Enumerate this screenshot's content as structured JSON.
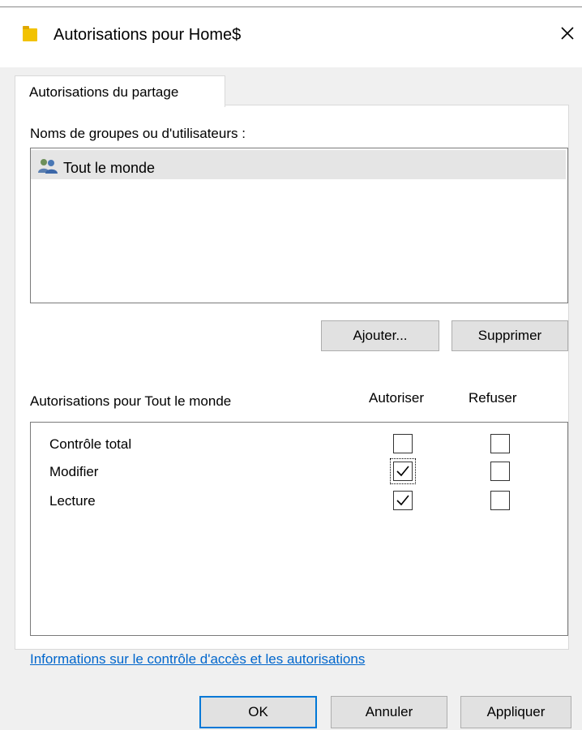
{
  "window": {
    "title": "Autorisations pour Home$",
    "icon": "folder-icon",
    "close_icon": "close-icon"
  },
  "tabs": [
    {
      "label": "Autorisations du partage",
      "active": true
    }
  ],
  "groups": {
    "label": "Noms de groupes ou d'utilisateurs :",
    "items": [
      {
        "name": "Tout le monde",
        "icon": "users-icon",
        "selected": true
      }
    ]
  },
  "group_buttons": {
    "add": "Ajouter...",
    "remove": "Supprimer"
  },
  "permissions": {
    "label": "Autorisations pour Tout le monde",
    "allow_header": "Autoriser",
    "deny_header": "Refuser",
    "rows": [
      {
        "name": "Contrôle total",
        "allow": false,
        "deny": false
      },
      {
        "name": "Modifier",
        "allow": true,
        "deny": false
      },
      {
        "name": "Lecture",
        "allow": true,
        "deny": false
      }
    ]
  },
  "link": "Informations sur le contrôle d'accès et les autorisations",
  "dialog_buttons": {
    "ok": "OK",
    "cancel": "Annuler",
    "apply": "Appliquer"
  },
  "colors": {
    "link": "#0066cc",
    "folder": "#f2c200",
    "default_button_border": "#0078d7",
    "selection": "#e5e5e5"
  }
}
